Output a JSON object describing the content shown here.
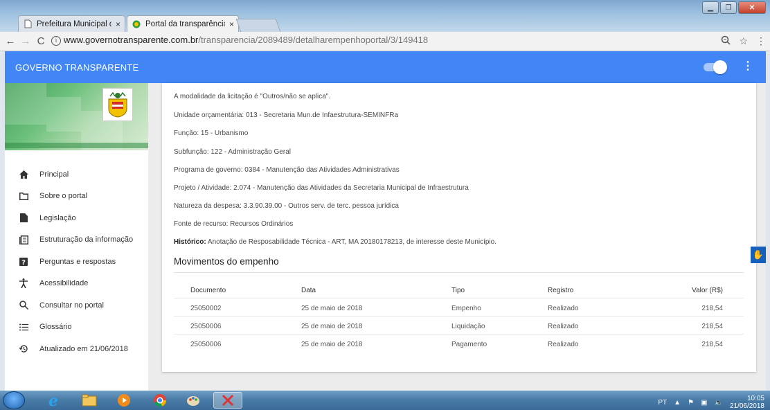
{
  "browser": {
    "tabs": [
      {
        "label": "Prefeitura Municipal de A",
        "close": "×"
      },
      {
        "label": "Portal da transparência",
        "close": "×"
      }
    ],
    "url_host": "www.governotransparente.com.br",
    "url_path": "/transparencia/2089489/detalharempenhoportal/3/149418"
  },
  "appbar": {
    "title": "GOVERNO TRANSPARENTE"
  },
  "sidebar": {
    "items": [
      {
        "label": "Principal",
        "icon": "home-icon"
      },
      {
        "label": "Sobre o portal",
        "icon": "folder-icon"
      },
      {
        "label": "Legislação",
        "icon": "file-icon"
      },
      {
        "label": "Estruturação da informação",
        "icon": "list-icon"
      },
      {
        "label": "Perguntas e respostas",
        "icon": "help-icon"
      },
      {
        "label": "Acessibilidade",
        "icon": "accessibility-icon"
      },
      {
        "label": "Consultar no portal",
        "icon": "search-icon"
      },
      {
        "label": "Glossário",
        "icon": "glossary-icon"
      },
      {
        "label": "Atualizado em 21/06/2018",
        "icon": "history-icon"
      }
    ]
  },
  "details": {
    "modalidade": "A modalidade da licitação é \"Outros/não se aplica\".",
    "unidade": "Unidade orçamentária: 013 - Secretaria Mun.de Infaestrutura-SEMINFRa",
    "funcao": "Função: 15 - Urbanismo",
    "subfuncao": "Subfunção: 122 - Administração Geral",
    "programa": "Programa de governo: 0384 - Manutenção das Atividades Administrativas",
    "projeto": "Projeto / Atividade: 2.074 - Manutenção das Atividades da Secretaria Municipal de Infraestrutura",
    "natureza": "Natureza da despesa: 3.3.90.39.00 - Outros serv. de terc. pessoa jurídica",
    "fonte": "Fonte de recurso: Recursos Ordinários",
    "historico_label": "Histórico:",
    "historico_text": " Anotação de Resposabilidade Técnica - ART, MA 20180178213, de interesse deste Município."
  },
  "movimentos": {
    "title": "Movimentos do empenho",
    "headers": {
      "documento": "Documento",
      "data": "Data",
      "tipo": "Tipo",
      "registro": "Registro",
      "valor": "Valor (R$)"
    },
    "rows": [
      {
        "documento": "25050002",
        "data": "25 de maio de 2018",
        "tipo": "Empenho",
        "registro": "Realizado",
        "valor": "218,54"
      },
      {
        "documento": "25050006",
        "data": "25 de maio de 2018",
        "tipo": "Liquidação",
        "registro": "Realizado",
        "valor": "218,54"
      },
      {
        "documento": "25050006",
        "data": "25 de maio de 2018",
        "tipo": "Pagamento",
        "registro": "Realizado",
        "valor": "218,54"
      }
    ]
  },
  "taskbar": {
    "lang": "PT",
    "time": "10:05",
    "date": "21/06/2018"
  },
  "colors": {
    "appbar": "#4286f5",
    "a11y": "#1560bd"
  }
}
